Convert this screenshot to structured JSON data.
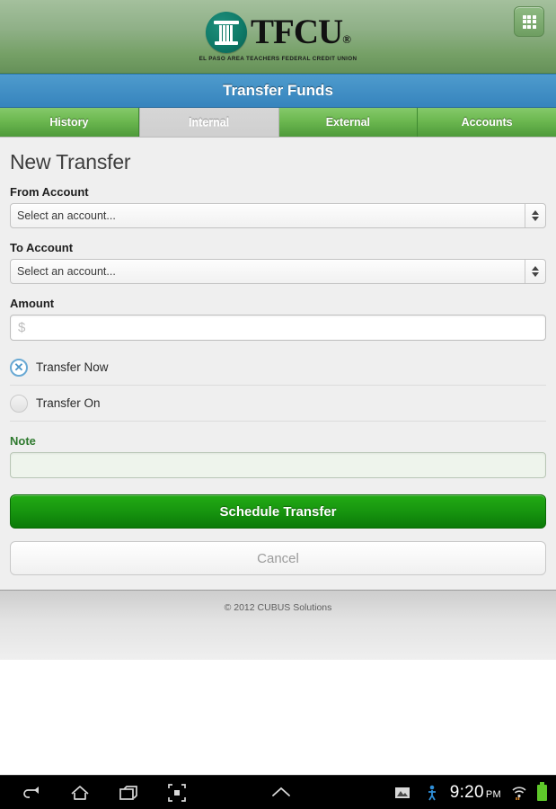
{
  "header": {
    "logo_mark": "tfcu-column-emblem",
    "logo_text": "TFCU",
    "logo_registered": "®",
    "logo_subtitle": "EL PASO AREA TEACHERS FEDERAL CREDIT UNION",
    "menu_icon": "grid-menu-icon",
    "colors": {
      "top": "#a4c09d",
      "bottom": "#669159"
    }
  },
  "title_bar": {
    "title": "Transfer Funds",
    "color": "#3684bd"
  },
  "tabs": [
    {
      "label": "History",
      "active": false
    },
    {
      "label": "Internal",
      "active": true
    },
    {
      "label": "External",
      "active": false
    },
    {
      "label": "Accounts",
      "active": false
    }
  ],
  "form": {
    "page_title": "New Transfer",
    "from_account": {
      "label": "From Account",
      "value": "Select an account...",
      "spinner_icon": "up-down-arrows-icon"
    },
    "to_account": {
      "label": "To Account",
      "value": "Select an account...",
      "spinner_icon": "up-down-arrows-icon"
    },
    "amount": {
      "label": "Amount",
      "value": "",
      "placeholder": "$"
    },
    "schedule_options": [
      {
        "label": "Transfer Now",
        "selected": true,
        "mark": "✕"
      },
      {
        "label": "Transfer On",
        "selected": false,
        "mark": ""
      }
    ],
    "note": {
      "label": "Note",
      "value": "",
      "placeholder": "",
      "label_color": "#2f7a2f"
    },
    "submit_label": "Schedule Transfer",
    "cancel_label": "Cancel",
    "submit_color": "#17950f"
  },
  "footer": {
    "copyright": "© 2012 CUBUS Solutions"
  },
  "navbar": {
    "buttons": [
      {
        "icon": "back-icon"
      },
      {
        "icon": "home-icon"
      },
      {
        "icon": "recent-apps-icon"
      },
      {
        "icon": "screenshot-icon"
      },
      {
        "icon": "chevron-up-icon"
      }
    ],
    "status": {
      "image_icon": "gallery-icon",
      "sync_icon": "usb-sync-icon",
      "time": "9:20",
      "ampm": "PM",
      "wifi_icon": "wifi-icon",
      "battery_icon": "battery-full-icon",
      "battery_color": "#5ec82a"
    }
  }
}
